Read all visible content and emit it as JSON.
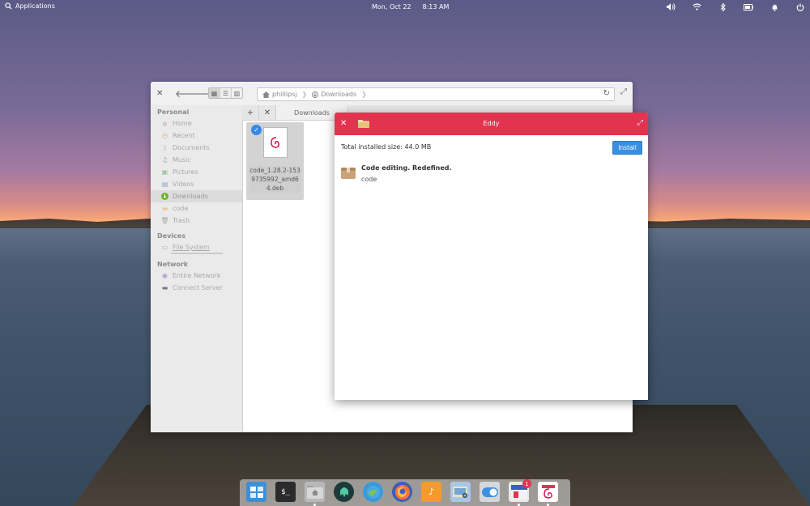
{
  "panel": {
    "applications": "Applications",
    "date": "Mon, Oct 22",
    "time": "8:13 AM",
    "indicators": [
      "volume-icon",
      "wifi-icon",
      "bluetooth-icon",
      "battery-icon",
      "notifications-icon",
      "power-icon"
    ]
  },
  "file_manager": {
    "path": {
      "home": "phillipsj",
      "current": "Downloads"
    },
    "sidebar": {
      "personal_label": "Personal",
      "personal": [
        "Home",
        "Recent",
        "Documents",
        "Music",
        "Pictures",
        "Videos",
        "Downloads",
        "code",
        "Trash"
      ],
      "devices_label": "Devices",
      "devices": [
        "File System"
      ],
      "network_label": "Network",
      "network": [
        "Entire Network",
        "Connect Server"
      ]
    },
    "tab": "Downloads",
    "file": {
      "name": "code_1.28.2-1539735992_amd64.deb"
    }
  },
  "eddy": {
    "title": "Eddy",
    "total_size": "Total installed size: 44.0 MB",
    "install_label": "Install",
    "package": {
      "summary": "Code editing. Redefined.",
      "name": "code"
    }
  },
  "dock": {
    "badge_count": "1",
    "apps": [
      "multitasking-view",
      "terminal",
      "files",
      "appcenter",
      "web-browser",
      "firefox",
      "music",
      "photos",
      "system-settings",
      "eddy-installer",
      "debian-package"
    ]
  },
  "colors": {
    "eddy_header": "#e3334f",
    "accent_blue": "#3a8fe0"
  }
}
